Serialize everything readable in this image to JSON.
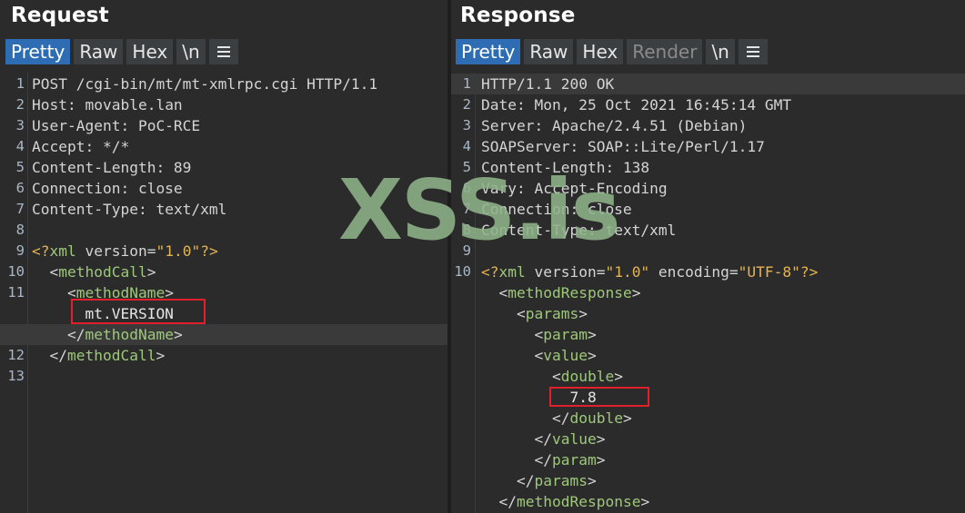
{
  "request": {
    "title": "Request",
    "tabs": [
      {
        "label": "Pretty",
        "active": true
      },
      {
        "label": "Raw"
      },
      {
        "label": "Hex"
      },
      {
        "label": "\\n"
      }
    ],
    "lines": [
      {
        "n": "1",
        "text": "POST /cgi-bin/mt/mt-xmlrpc.cgi HTTP/1.1"
      },
      {
        "n": "2",
        "key": "Host:",
        "val": " movable.lan"
      },
      {
        "n": "3",
        "key": "User-Agent:",
        "val": " PoC-RCE"
      },
      {
        "n": "4",
        "key": "Accept:",
        "val": " */*"
      },
      {
        "n": "5",
        "key": "Content-Length:",
        "val": " 89"
      },
      {
        "n": "6",
        "key": "Connection:",
        "val": " close"
      },
      {
        "n": "7",
        "key": "Content-Type:",
        "val": " text/xml"
      },
      {
        "n": "8",
        "text": ""
      },
      {
        "n": "9",
        "xmldecl": "<?xml version=\"1.0\"?>"
      },
      {
        "n": "10",
        "open": "  <methodCall>"
      },
      {
        "n": "11",
        "open": "    <methodName>"
      },
      {
        "n": "",
        "value": "      mt.VERSION"
      },
      {
        "n": "",
        "close": "    </methodName>"
      },
      {
        "n": "12",
        "close": "  </methodCall>"
      },
      {
        "n": "13",
        "text": ""
      }
    ]
  },
  "response": {
    "title": "Response",
    "tabs": [
      {
        "label": "Pretty",
        "active": true
      },
      {
        "label": "Raw"
      },
      {
        "label": "Hex"
      },
      {
        "label": "Render",
        "disabled": true
      },
      {
        "label": "\\n"
      }
    ],
    "lines": [
      {
        "n": "1",
        "text": "HTTP/1.1 200 OK"
      },
      {
        "n": "2",
        "key": "Date:",
        "val": " Mon, 25 Oct 2021 16:45:14 GMT"
      },
      {
        "n": "3",
        "key": "Server:",
        "val": " Apache/2.4.51 (Debian)"
      },
      {
        "n": "4",
        "key": "SOAPServer:",
        "val": " SOAP::Lite/Perl/1.17"
      },
      {
        "n": "5",
        "key": "Content-Length:",
        "val": " 138"
      },
      {
        "n": "6",
        "key": "Vary:",
        "val": " Accept-Encoding"
      },
      {
        "n": "7",
        "key": "Connection:",
        "val": " close"
      },
      {
        "n": "8",
        "key": "Content-Type:",
        "val": " text/xml"
      },
      {
        "n": "9",
        "text": ""
      },
      {
        "n": "10",
        "xmldecl2": true
      },
      {
        "n": "",
        "open": "  <methodResponse>"
      },
      {
        "n": "",
        "open": "    <params>"
      },
      {
        "n": "",
        "open": "      <param>"
      },
      {
        "n": "",
        "open": "      <value>"
      },
      {
        "n": "",
        "open": "        <double>"
      },
      {
        "n": "",
        "value": "          7.8"
      },
      {
        "n": "",
        "close": "        </double>"
      },
      {
        "n": "",
        "close": "      </value>"
      },
      {
        "n": "",
        "close": "      </param>"
      },
      {
        "n": "",
        "close": "    </params>"
      },
      {
        "n": "",
        "close": "  </methodResponse>"
      }
    ],
    "xmldecl_parts": {
      "open": "<?xml ",
      "a1": "version=",
      "v1": "\"1.0\"",
      "a2": " encoding=",
      "v2": "\"UTF-8\"",
      "close": "?>"
    }
  },
  "watermark": "XSS.is",
  "colors": {
    "active_tab": "#2e6db4",
    "tag": "#9ec87a",
    "string": "#e6b450",
    "highlight_box": "#e0202a"
  }
}
